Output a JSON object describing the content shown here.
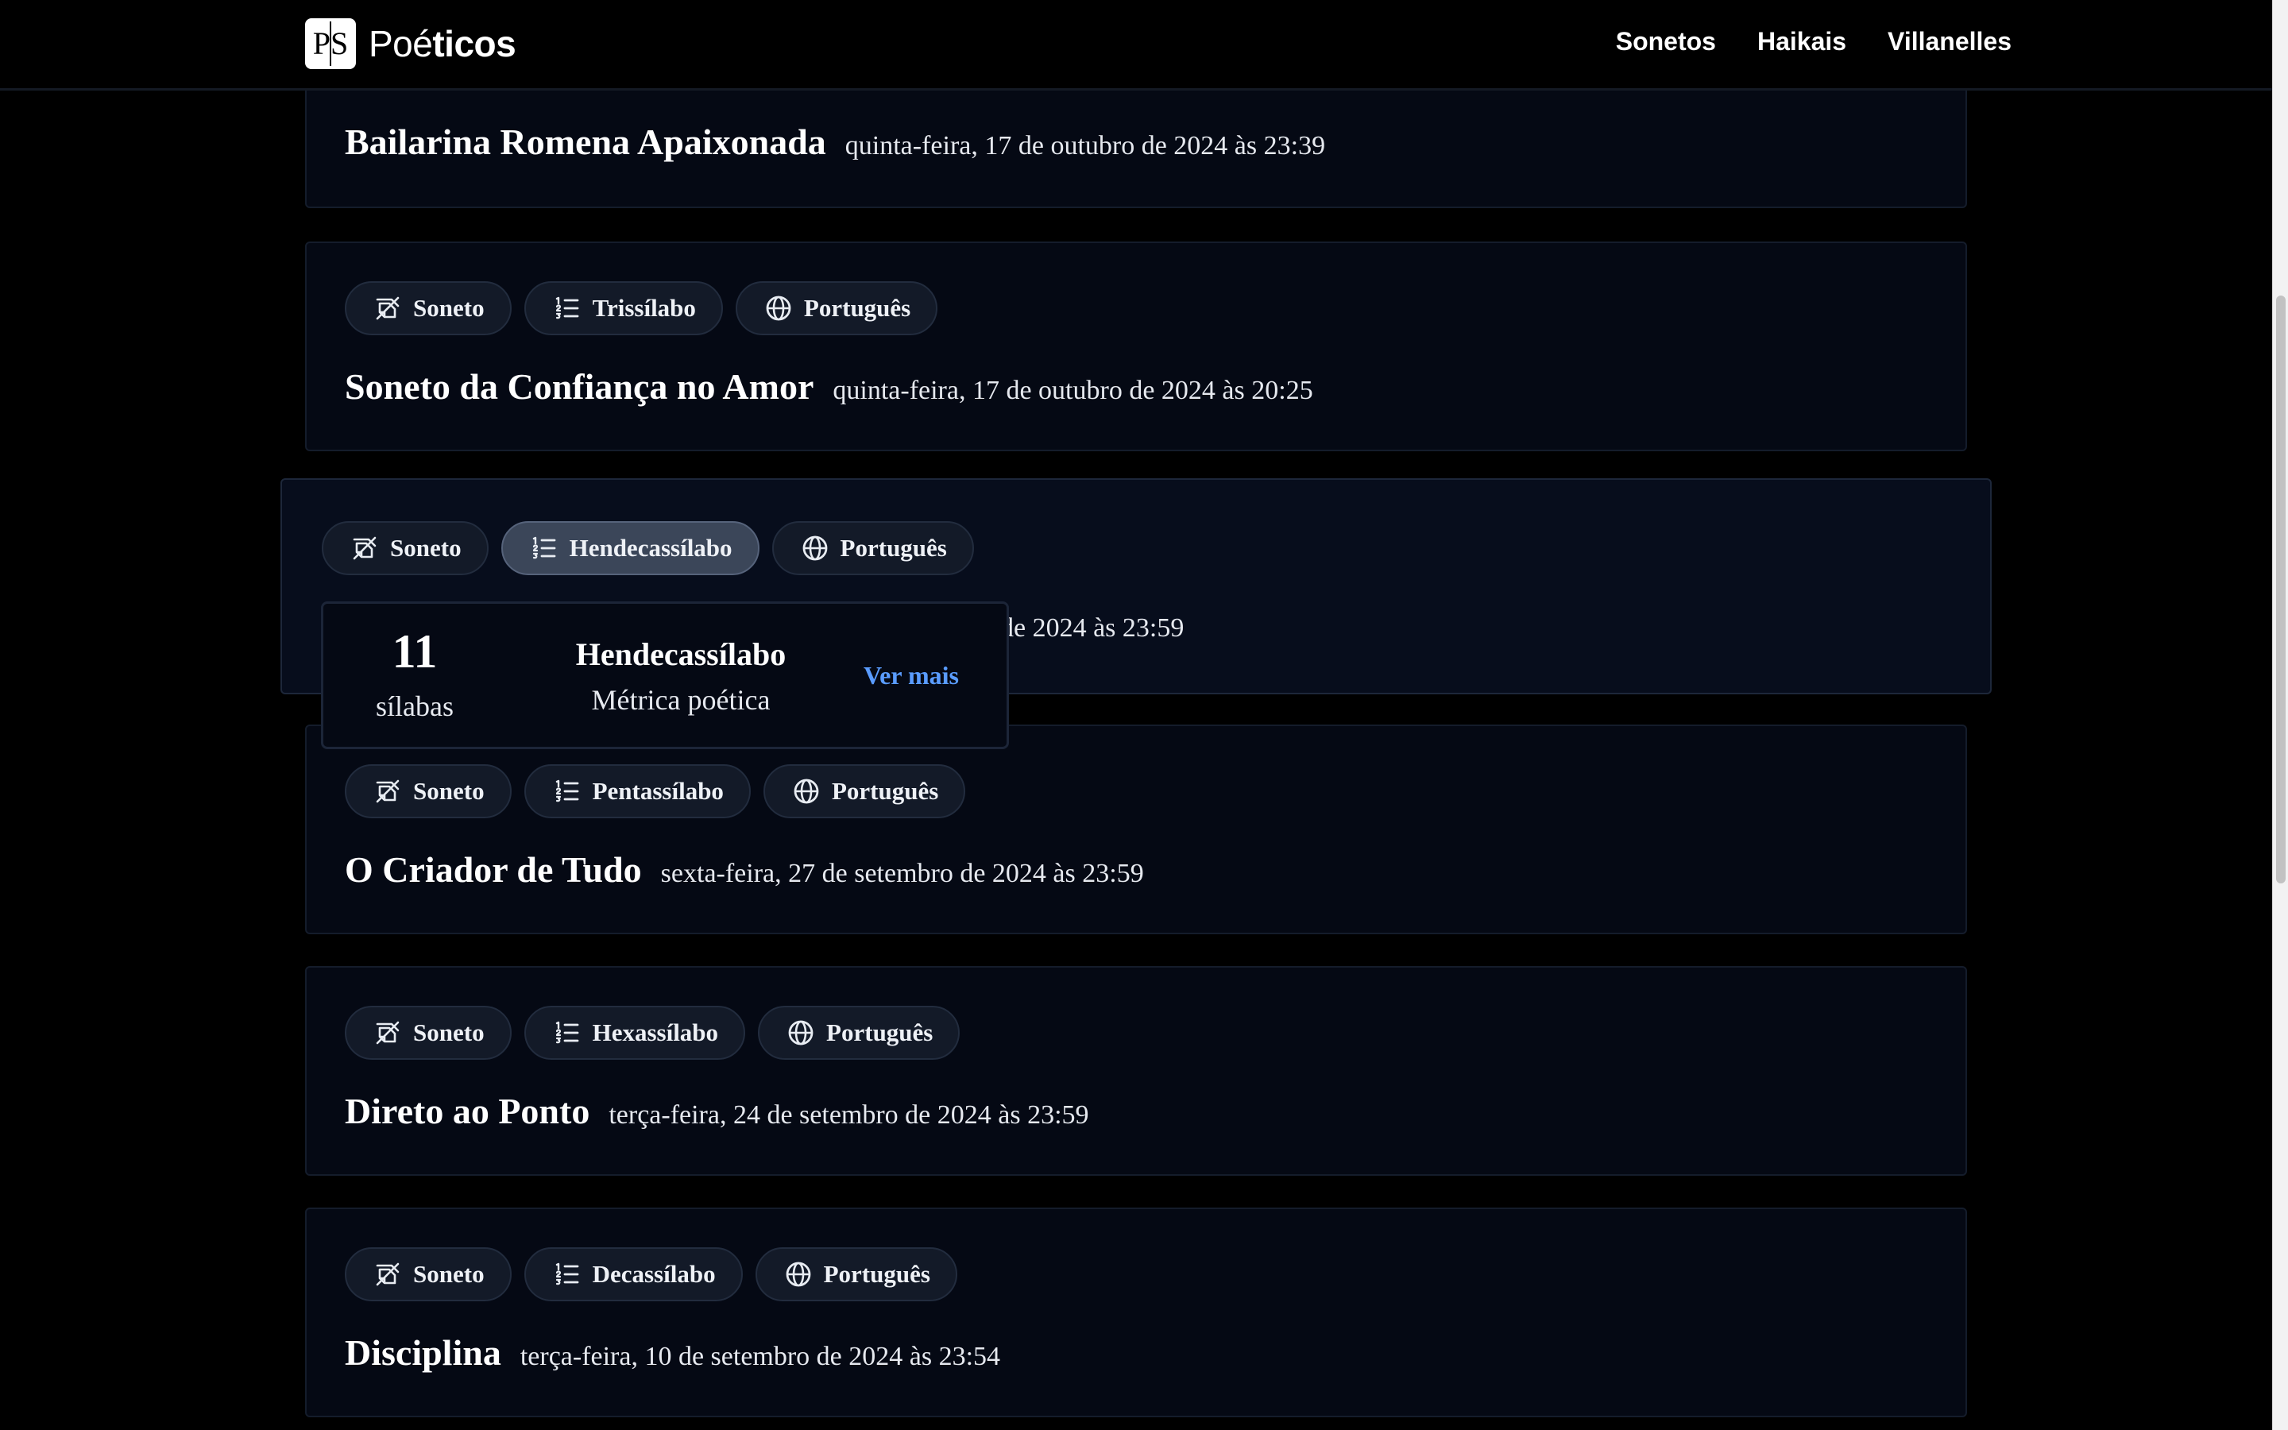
{
  "header": {
    "logo_mark": "PS",
    "logo_text_light": "Poé",
    "logo_text_bold": "ticos",
    "nav": [
      "Sonetos",
      "Haikais",
      "Villanelles"
    ]
  },
  "cards": [
    {
      "tags": [],
      "title": "Bailarina Romena Apaixonada",
      "date": "quinta-feira, 17 de outubro de 2024 às 23:39"
    },
    {
      "tags": [
        {
          "icon": "sonnet-icon",
          "label": "Soneto"
        },
        {
          "icon": "meter-list-icon",
          "label": "Trissílabo"
        },
        {
          "icon": "globe-icon",
          "label": "Português"
        }
      ],
      "title": "Soneto da Confiança no Amor",
      "date": "quinta-feira, 17 de outubro de 2024 às 20:25"
    },
    {
      "tags": [
        {
          "icon": "sonnet-icon",
          "label": "Soneto"
        },
        {
          "icon": "meter-list-icon",
          "label": "Hendecassílabo"
        },
        {
          "icon": "globe-icon",
          "label": "Português"
        }
      ],
      "date_visible": "de 2024 às 23:59"
    },
    {
      "tags": [
        {
          "icon": "sonnet-icon",
          "label": "Soneto"
        },
        {
          "icon": "meter-list-icon",
          "label": "Pentassílabo"
        },
        {
          "icon": "globe-icon",
          "label": "Português"
        }
      ],
      "title": "O Criador de Tudo",
      "date": "sexta-feira, 27 de setembro de 2024 às 23:59"
    },
    {
      "tags": [
        {
          "icon": "sonnet-icon",
          "label": "Soneto"
        },
        {
          "icon": "meter-list-icon",
          "label": "Hexassílabo"
        },
        {
          "icon": "globe-icon",
          "label": "Português"
        }
      ],
      "title": "Direto ao Ponto",
      "date": "terça-feira, 24 de setembro de 2024 às 23:59"
    },
    {
      "tags": [
        {
          "icon": "sonnet-icon",
          "label": "Soneto"
        },
        {
          "icon": "meter-list-icon",
          "label": "Decassílabo"
        },
        {
          "icon": "globe-icon",
          "label": "Português"
        }
      ],
      "title": "Disciplina",
      "date": "terça-feira, 10 de setembro de 2024 às 23:54"
    }
  ],
  "popover": {
    "count": "11",
    "unit": "sílabas",
    "name": "Hendecassílabo",
    "subtitle": "Métrica poética",
    "link": "Ver mais"
  },
  "colors": {
    "background": "#000000",
    "card": "#050914",
    "tag": "#131a28",
    "tag_active": "#3b4659",
    "link": "#5a9cff"
  }
}
